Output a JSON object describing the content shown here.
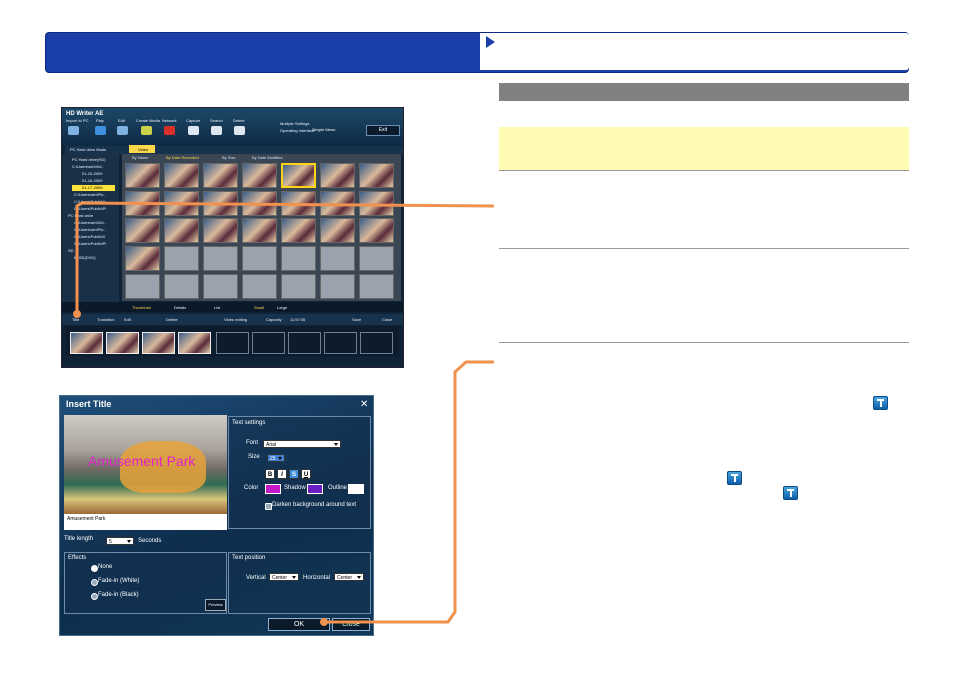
{
  "colors": {
    "header_blue": "#1a3fa8",
    "callout_line": "#f0914d",
    "note_yellow": "#fffbb3",
    "section_gray": "#808080"
  },
  "screenshot_1": {
    "window_title": "HD Writer AE",
    "toolbar": [
      "Import to PC",
      "Play",
      "Edit",
      "Create Media",
      "Network",
      "Capture",
      "Search",
      "Delete"
    ],
    "settings_label": "Multiple Settings",
    "operating_label": "Operating Interface:",
    "simple_menu": "Simple Menu",
    "exit_label": "Exit",
    "mode_label": "PC Hard drive Mode",
    "video_tab": "Video",
    "sort_options": [
      "By Name",
      "By Date Recorded",
      "By Size",
      "By Date Modified"
    ],
    "tree": [
      "PC Hard drive(HD)",
      "C:\\Users\\win\\Vid..",
      "01-15-2009",
      "01-16-2009",
      "01-17-2009",
      "C:\\Users\\win\\Pic..",
      "C:\\Users\\Public\\V",
      "C:\\Users\\Public\\Pi",
      "PC Hard drive",
      "C:\\Users\\win\\Vid..",
      "C:\\Users\\win\\Pic..",
      "C:\\Users\\Public\\V",
      "C:\\Users\\Public\\Pi",
      "SD",
      "E:\\SD(DVD)"
    ],
    "view_tabs": [
      "Thumbnail",
      "Details",
      "List",
      "Small",
      "Large"
    ],
    "edit_bar": [
      "Title",
      "Transition",
      "Edit",
      "Delete",
      "Video editing",
      "Capacity",
      "Save",
      "Close"
    ],
    "capacity_value": "11:57:05"
  },
  "screenshot_2": {
    "dialog_title": "Insert Title",
    "overlay_text": "Amusement Park",
    "caption_text": "Amusement Park",
    "text_settings": "Text settings",
    "font_label": "Font",
    "font_value": "Arial",
    "size_label": "Size",
    "size_value": "25",
    "format_buttons": [
      "B",
      "I",
      "S",
      "U"
    ],
    "color_label": "Color",
    "shadow_label": "Shadow",
    "outline_label": "Outline",
    "darken_label": "Darken background around text",
    "title_length_label": "Title length",
    "title_length_value": "5",
    "seconds_label": "Seconds",
    "effects_label": "Effects",
    "effects": [
      "None",
      "Fade-in (White)",
      "Fade-in (Black)"
    ],
    "preview_label": "Preview",
    "text_position_label": "Text position",
    "vertical_label": "Vertical",
    "vertical_value": "Center",
    "horizontal_label": "Horizontal",
    "horizontal_value": "Center",
    "ok_label": "OK",
    "close_label": "Close"
  }
}
